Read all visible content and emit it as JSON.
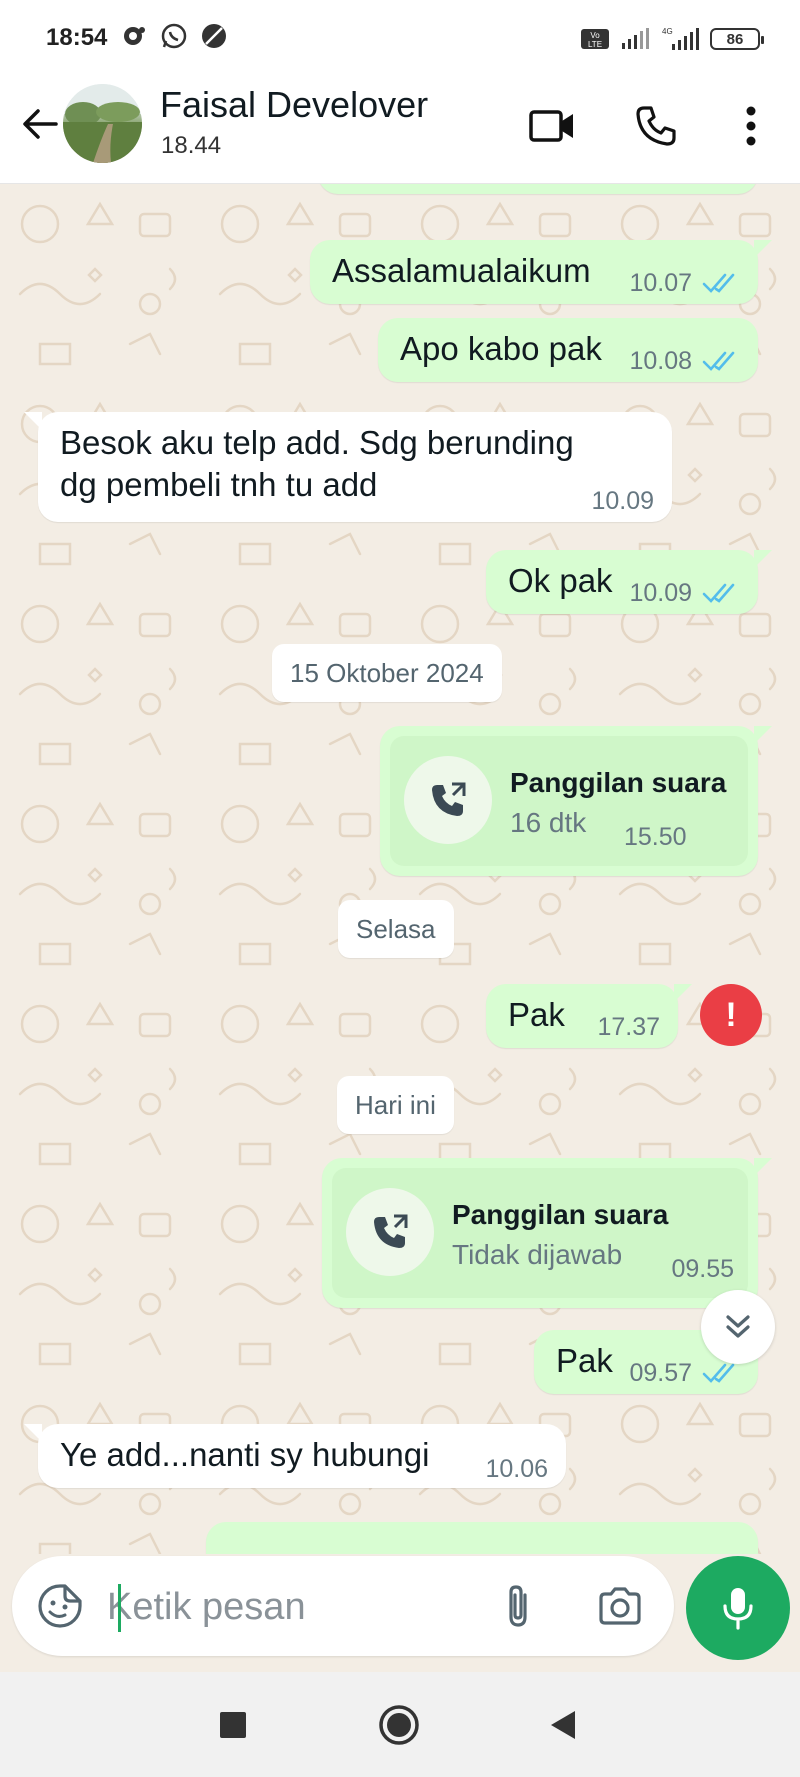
{
  "status_bar": {
    "time": "18:54",
    "battery": "86",
    "icons": [
      "notification-icon",
      "whatsapp-icon",
      "no-disturb-icon",
      "volte-icon",
      "signal-icon",
      "4g-signal-icon",
      "battery-icon"
    ]
  },
  "header": {
    "contact_name": "Faisal Develover",
    "last_seen": "18.44",
    "icons": [
      "back-arrow-icon",
      "video-call-icon",
      "voice-call-icon",
      "more-options-icon"
    ]
  },
  "messages": [
    {
      "dir": "out",
      "text": "Assalamualaikum",
      "time": "10.07",
      "read": true
    },
    {
      "dir": "out",
      "text": "Apo kabo pak",
      "time": "10.08",
      "read": true
    },
    {
      "dir": "in",
      "text_line1": "Besok aku telp add. Sdg berunding",
      "text_line2": "dg pembeli tnh tu add",
      "time": "10.09"
    },
    {
      "dir": "out",
      "text": "Ok pak",
      "time": "10.09",
      "read": true
    },
    {
      "type": "date",
      "text": "15 Oktober 2024"
    },
    {
      "dir": "out",
      "type": "call",
      "title": "Panggilan suara",
      "sub": "16 dtk",
      "time": "15.50"
    },
    {
      "type": "date",
      "text": "Selasa"
    },
    {
      "dir": "out",
      "text": "Pak",
      "time": "17.37",
      "failed": true
    },
    {
      "type": "date",
      "text": "Hari ini"
    },
    {
      "dir": "out",
      "type": "call",
      "title": "Panggilan suara",
      "sub": "Tidak dijawab",
      "time": "09.55"
    },
    {
      "dir": "out",
      "text": "Pak",
      "time": "09.57",
      "read": true
    },
    {
      "dir": "in",
      "text": "Ye add...nanti sy hubungi",
      "time": "10.06"
    }
  ],
  "input": {
    "placeholder": "Ketik pesan"
  },
  "colors": {
    "accent": "#1daa61",
    "outgoing_bubble": "#d8fdd2",
    "chat_bg": "#f3ede4",
    "read_ticks": "#53bdeb",
    "error": "#ea3e45"
  }
}
